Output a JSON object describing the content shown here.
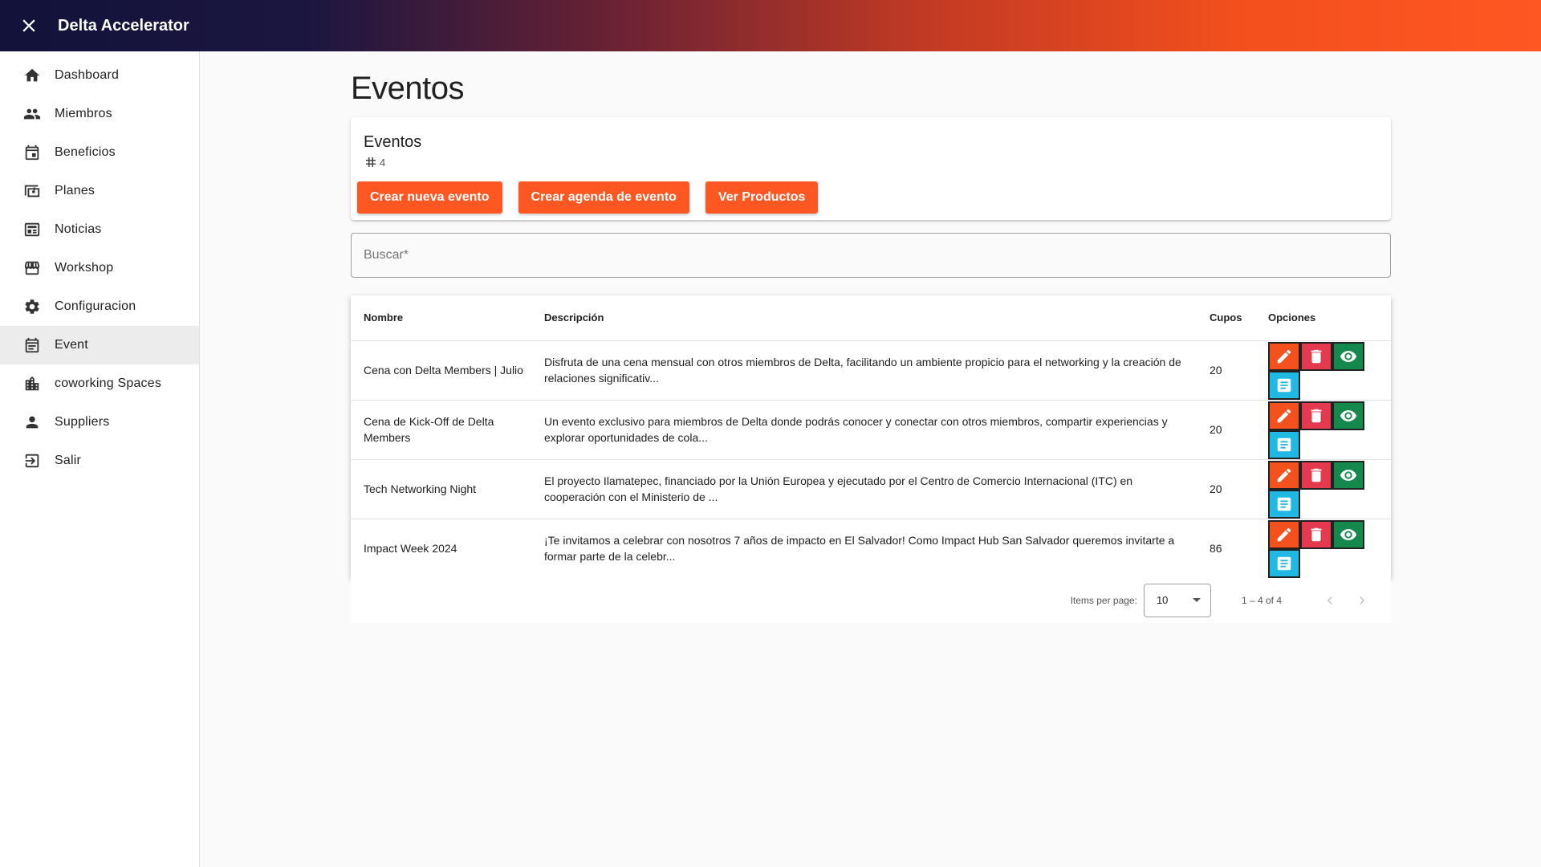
{
  "app": {
    "title": "Delta Accelerator",
    "close_icon": "close-icon"
  },
  "sidebar": {
    "items": [
      {
        "label": "Dashboard",
        "icon": "home-icon"
      },
      {
        "label": "Miembros",
        "icon": "people-icon"
      },
      {
        "label": "Beneficios",
        "icon": "calendar-icon"
      },
      {
        "label": "Planes",
        "icon": "money-icon"
      },
      {
        "label": "Noticias",
        "icon": "newspaper-icon"
      },
      {
        "label": "Workshop",
        "icon": "store-icon"
      },
      {
        "label": "Configuracion",
        "icon": "gear-icon"
      },
      {
        "label": "Event",
        "icon": "event-icon",
        "active": true
      },
      {
        "label": "coworking Spaces",
        "icon": "building-icon"
      },
      {
        "label": "Suppliers",
        "icon": "person-icon"
      },
      {
        "label": "Salir",
        "icon": "logout-icon"
      }
    ]
  },
  "page": {
    "title": "Eventos"
  },
  "card": {
    "title": "Eventos",
    "count": "4",
    "buttons": {
      "create_event": "Crear nueva evento",
      "create_agenda": "Crear agenda de evento",
      "view_products": "Ver Productos"
    }
  },
  "search": {
    "placeholder": "Buscar*",
    "value": ""
  },
  "table": {
    "headers": {
      "name": "Nombre",
      "description": "Descripción",
      "cupos": "Cupos",
      "options": "Opciones"
    },
    "rows": [
      {
        "name": "Cena con Delta Members | Julio",
        "description": "Disfruta de una cena mensual con otros miembros de Delta, facilitando un ambiente propicio para el networking y la creación de relaciones significativ...",
        "cupos": "20"
      },
      {
        "name": "Cena de Kick-Off de Delta Members",
        "description": "Un evento exclusivo para miembros de Delta donde podrás conocer y conectar con otros miembros, compartir experiencias y explorar oportunidades de cola...",
        "cupos": "20"
      },
      {
        "name": "Tech Networking Night",
        "description": "El proyecto Ilamatepec, financiado por la Unión Europea y ejecutado por el Centro de Comercio Internacional (ITC) en cooperación con el Ministerio de ...",
        "cupos": "20"
      },
      {
        "name": "Impact Week 2024",
        "description": "¡Te invitamos a celebrar con nosotros 7 años de impacto en El Salvador! Como Impact Hub San Salvador queremos invitarte a formar parte de la celebr...",
        "cupos": "86"
      }
    ]
  },
  "paginator": {
    "items_per_page_label": "Items per page:",
    "page_size": "10",
    "range": "1 – 4 of 4"
  },
  "colors": {
    "accent": "#ff5722",
    "edit": "#f4511e",
    "delete": "#e53950",
    "view": "#14884d",
    "doc": "#1fb9e4"
  }
}
